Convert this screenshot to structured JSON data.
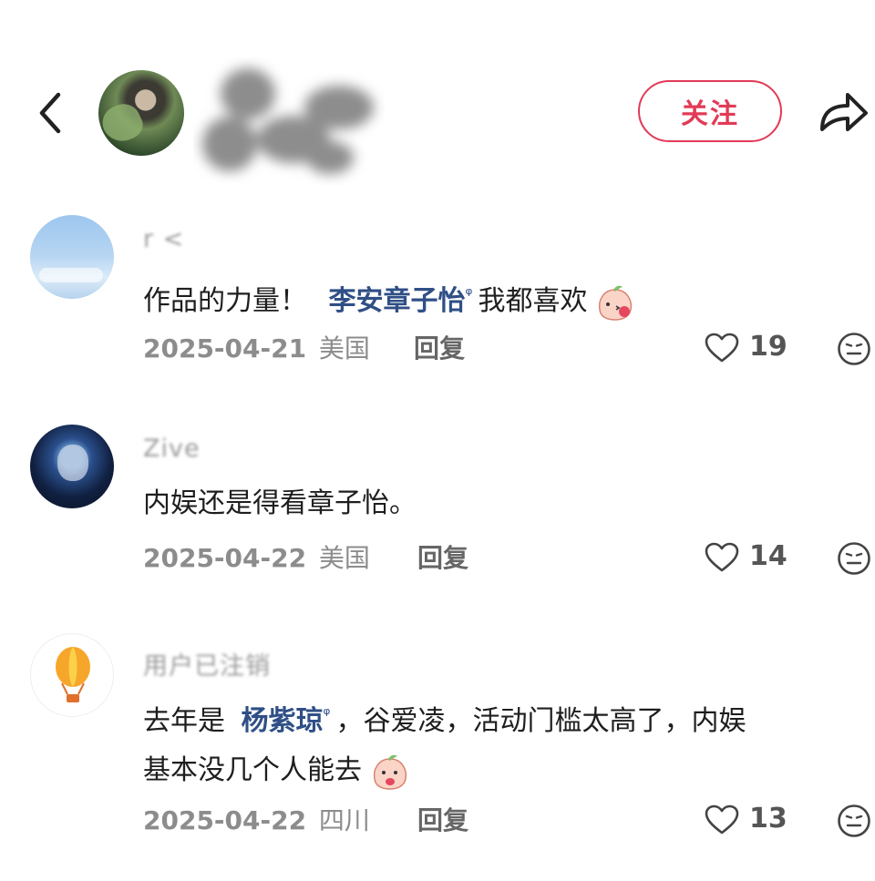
{
  "header": {
    "follow_label": "关注"
  },
  "comments": [
    {
      "username": "r  <",
      "text_before": "作品的力量！",
      "mention": "李安章子怡",
      "mention_glyph": "ᵠ",
      "text_after": "我都喜欢",
      "date": "2025-04-21",
      "region": "美国",
      "reply_label": "回复",
      "likes": "19"
    },
    {
      "username": "Zive",
      "text": "内娱还是得看章子怡。",
      "date": "2025-04-22",
      "region": "美国",
      "reply_label": "回复",
      "likes": "14"
    },
    {
      "username": "用户已注销",
      "text_before": "去年是",
      "mention": "杨紫琼",
      "mention_glyph": "ᵠ",
      "text_after_line1": "，谷爱凌，活动门槛太高了，内娱",
      "text_line2": "基本没几个人能去",
      "date": "2025-04-22",
      "region": "四川",
      "reply_label": "回复",
      "likes": "13"
    }
  ],
  "colors": {
    "accent": "#e23b57",
    "mention": "#2f4f86",
    "meta": "#8c8c8c"
  },
  "icons": [
    "back-icon",
    "share-icon",
    "heart-icon",
    "meh-face-icon",
    "peach-emoji-icon",
    "balloon-icon"
  ]
}
